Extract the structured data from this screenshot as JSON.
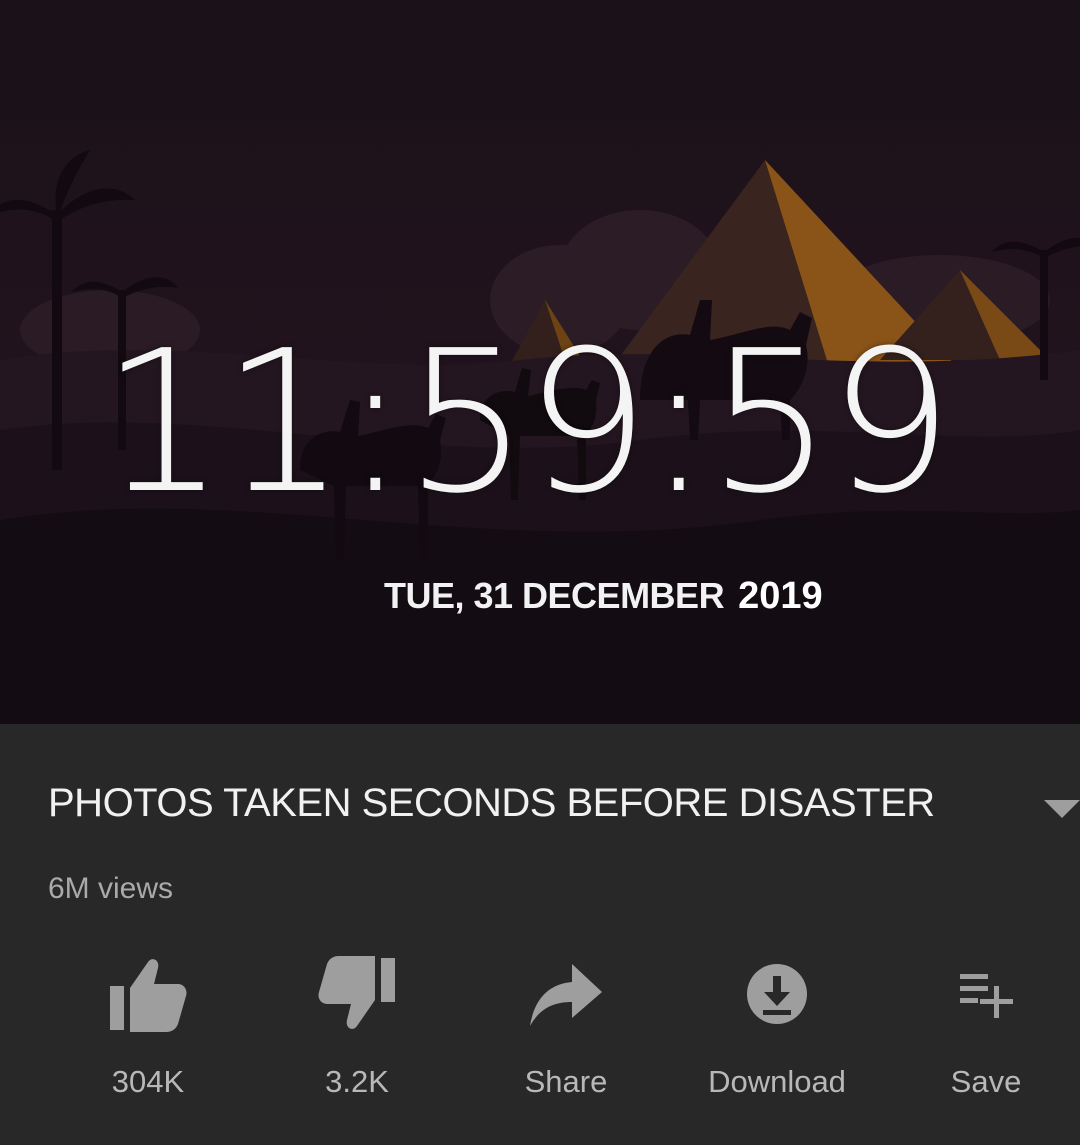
{
  "clock": {
    "time": "11:59:59",
    "day_date": "TUE, 31 DECEMBER",
    "year": "2019"
  },
  "video": {
    "title": "PHOTOS TAKEN SECONDS BEFORE DISASTER",
    "views": "6M views",
    "expand_icon": "caret-down-icon"
  },
  "actions": {
    "like": {
      "label": "304K",
      "icon": "thumbs-up-icon"
    },
    "dislike": {
      "label": "3.2K",
      "icon": "thumbs-down-icon"
    },
    "share": {
      "label": "Share",
      "icon": "share-arrow-icon"
    },
    "download": {
      "label": "Download",
      "icon": "download-icon"
    },
    "save": {
      "label": "Save",
      "icon": "playlist-add-icon"
    }
  },
  "colors": {
    "panel_background": "#282828",
    "icon_gray": "#9e9e9e",
    "label_gray": "#b8b8b8",
    "title_white": "#f1f1f1",
    "pyramid_orange": "#8a5418"
  }
}
